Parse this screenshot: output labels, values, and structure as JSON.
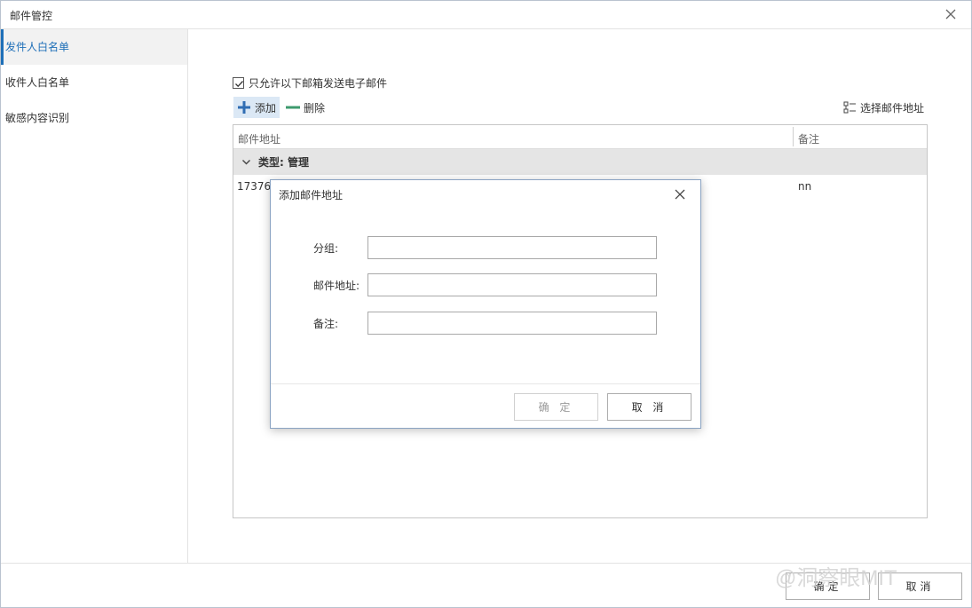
{
  "window": {
    "title": "邮件管控"
  },
  "sidebar": {
    "items": [
      {
        "label": "发件人白名单",
        "active": true
      },
      {
        "label": "收件人白名单",
        "active": false
      },
      {
        "label": "敏感内容识别",
        "active": false
      }
    ]
  },
  "content": {
    "restrict_checkbox": {
      "label": "只允许以下邮箱发送电子邮件",
      "checked": true
    },
    "toolbar": {
      "add_label": "添加",
      "delete_label": "删除",
      "pick_label": "选择邮件地址"
    },
    "table": {
      "columns": [
        "邮件地址",
        "备注"
      ],
      "group_label": "类型: 管理",
      "rows": [
        {
          "email": "17376",
          "note": "nn"
        }
      ]
    }
  },
  "footer": {
    "ok_label": "确定",
    "cancel_label": "取消"
  },
  "watermark": "@洞察眼MIT",
  "dialog": {
    "title": "添加邮件地址",
    "fields": [
      {
        "label": "分组:",
        "value": ""
      },
      {
        "label": "邮件地址:",
        "value": ""
      },
      {
        "label": "备注:",
        "value": ""
      }
    ],
    "ok_label": "确 定",
    "cancel_label": "取 消",
    "ok_disabled": true
  },
  "colors": {
    "accent": "#1e6fb8",
    "add_icon": "#2f6db3",
    "delete_icon": "#3d9a6e",
    "active_bg": "#f2f2f2",
    "group_bg": "#e5e5e5"
  }
}
